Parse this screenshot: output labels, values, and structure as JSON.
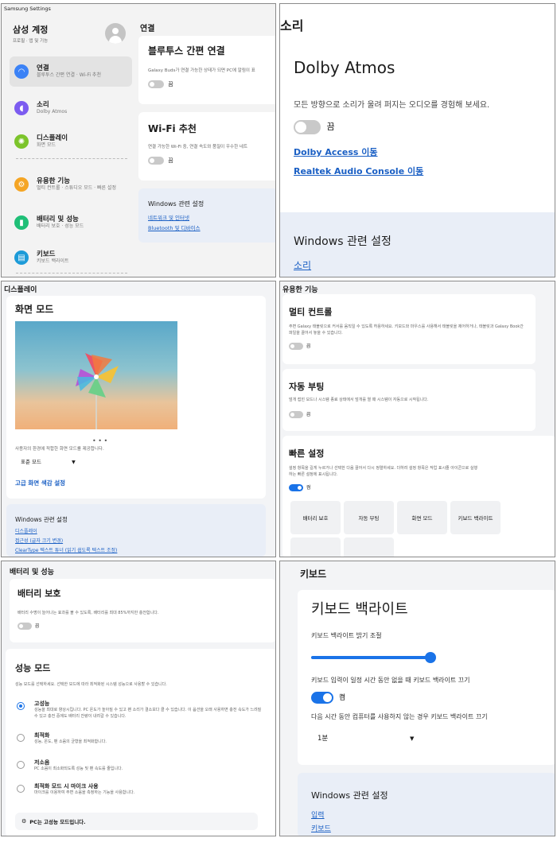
{
  "p1": {
    "app_title": "Samsung Settings",
    "account_title": "삼성 계정",
    "account_sub": "프로필 · 앱 및 기능",
    "nav": [
      {
        "label": "연결",
        "sub": "블루투스 간편 연결 · Wi-Fi 추천",
        "icon": "wifi-icon",
        "color": "#3b82f6"
      },
      {
        "label": "소리",
        "sub": "Dolby Atmos",
        "icon": "sound-icon",
        "color": "#7c5cf0"
      },
      {
        "label": "디스플레이",
        "sub": "화면 모드",
        "icon": "sun-icon",
        "color": "#7cc42b"
      },
      {
        "label": "유용한 기능",
        "sub": "멀티 컨트롤 · 스튜디오 모드 · 빠른 설정",
        "icon": "gear-icon",
        "color": "#f5a524"
      },
      {
        "label": "배터리 및 성능",
        "sub": "배터리 보호 · 성능 모드",
        "icon": "battery-icon",
        "color": "#1fbf77"
      },
      {
        "label": "키보드",
        "sub": "키보드 백라이트",
        "icon": "keyboard-icon",
        "color": "#1d9bd8"
      }
    ],
    "section_title": "연결",
    "bt_title": "블루투스 간편 연결",
    "bt_desc": "Galaxy Buds가 연결 가능한 상태가 되면 PC에 알림이 표",
    "bt_state": "끔",
    "wifi_title": "Wi-Fi 추천",
    "wifi_desc": "연결 가능한 Wi-Fi 중, 연결 속도와 품질이 우수한 네트",
    "wifi_state": "끔",
    "win_title": "Windows 관련 설정",
    "win_links": [
      "네트워크 및 인터넷",
      "Bluetooth 및 디바이스"
    ]
  },
  "p2": {
    "title": "소리",
    "card_title": "Dolby Atmos",
    "desc": "모든 방향으로 소리가 울려 퍼지는 오디오를 경험해 보세요.",
    "state": "끔",
    "links": [
      "Dolby Access 이동",
      "Realtek Audio Console 이동"
    ],
    "win_title": "Windows 관련 설정",
    "win_links": [
      "소리"
    ]
  },
  "p3": {
    "title": "디스플레이",
    "card_title": "화면 모드",
    "desc": "사용자의 환경에 적합한 화면 모드를 제공합니다.",
    "mode": "표준 모드",
    "adv": "고급 화면 색감 설정",
    "win_title": "Windows 관련 설정",
    "win_links": [
      "디스플레이",
      "접근성 (글자 크기 변경)",
      "ClearType 텍스트 튜너 (읽기 쉽도록 텍스트 조정)"
    ]
  },
  "p4": {
    "title": "유용한 기능",
    "mc_title": "멀티 컨트롤",
    "mc_desc": "주변 Galaxy 태블릿으로 커서를 움직일 수 있도록 허용하세요. 키보드와 마우스를 사용해서 태블릿을 제어하거나, 태블릿과 Galaxy Book간 파일을 끌어서 놓을 수 있습니다.",
    "mc_state": "끔",
    "ab_title": "자동 부팅",
    "ab_desc": "덮개 접힌 모드나 시스템 종료 상태에서 덮개를 열 때 시스템이 자동으로 시작됩니다.",
    "ab_state": "끔",
    "qs_title": "빠른 설정",
    "qs_desc": "설정 항목을 길게 누르거나 선택한 다음 끌어서 다시 정렬하세요. 더하려 설정 항목은 작업 표시줄 아이콘으로 실행하는 빠른 설정에 표시됩니다.",
    "qs_state": "켬",
    "tiles": [
      "배터리 보호",
      "자동 부팅",
      "화면 모드",
      "키보드 백라이트"
    ]
  },
  "p5": {
    "title": "배터리 및 성능",
    "bp_title": "배터리 보호",
    "bp_desc": "배터리 수명이 늘어나는 효과를 볼 수 있도록, 배터리를 최대 85%까지만 충전합니다.",
    "bp_state": "끔",
    "pm_title": "성능 모드",
    "pm_desc": "성능 모드를 선택하세요. 선택한 모드에 따라 최적화된 시스템 성능으로 사용할 수 있습니다.",
    "options": [
      {
        "label": "고성능",
        "desc": "성능을 최대로 향상시킵니다. PC 온도가 높아질 수 있고 팬 소리가 결소보다 클 수 있습니다. 이 옵션을 오래 사용하면 충전 속도가 느려질 수 있고 충전 중에도 배터리 잔량이 내려갈 수 있습니다.",
        "selected": true
      },
      {
        "label": "최적화",
        "desc": "성능, 온도, 팬 소음의 균형을 최적화합니다.",
        "selected": false
      },
      {
        "label": "저소음",
        "desc": "PC 소음이 최소화되도록 성능 및 팬 속도를 줄입니다.",
        "selected": false
      },
      {
        "label": "최적화 모드 시 마이크 사용",
        "desc": "마이크를 이용하여 주변 소음을 측정하는 기능을 사용합니다.",
        "selected": false
      }
    ],
    "notice": "PC는 고성능 모드입니다."
  },
  "p6": {
    "title": "키보드",
    "card_title": "키보드 백라이트",
    "brightness_label": "키보드 백라이트 밝기 조절",
    "brightness_value": 1.0,
    "auto_off_label": "키보드 입력이 일정 시간 동안 없을 때 키보드 백라이트 끄기",
    "auto_off_state": "켬",
    "idle_label": "다음 시간 동안 컴퓨터를 사용하지 않는 경우 키보드 백라이트 끄기",
    "idle_value": "1분",
    "win_title": "Windows 관련 설정",
    "win_links": [
      "입력",
      "키보드"
    ]
  }
}
